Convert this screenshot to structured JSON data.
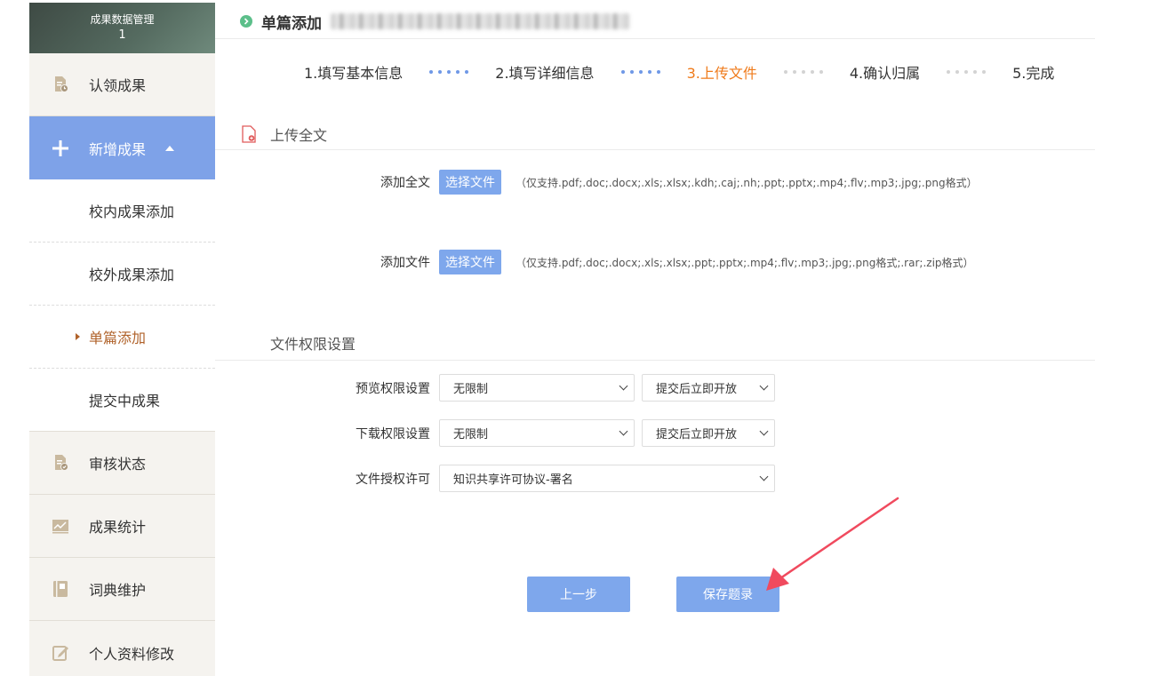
{
  "sidebar": {
    "header_title": "成果数据管理",
    "header_count": "1",
    "items": [
      {
        "label": "认领成果",
        "icon": "document-clock-icon"
      },
      {
        "label": "新增成果",
        "icon": "plus-icon"
      },
      {
        "label": "校内成果添加"
      },
      {
        "label": "校外成果添加"
      },
      {
        "label": "单篇添加"
      },
      {
        "label": "提交中成果"
      },
      {
        "label": "审核状态",
        "icon": "document-check-icon"
      },
      {
        "label": "成果统计",
        "icon": "chart-icon"
      },
      {
        "label": "词典维护",
        "icon": "book-icon"
      },
      {
        "label": "个人资料修改",
        "icon": "edit-icon"
      }
    ]
  },
  "header": {
    "title": "单篇添加"
  },
  "steps": [
    "1.填写基本信息",
    "2.填写详细信息",
    "3.上传文件",
    "4.确认归属",
    "5.完成"
  ],
  "current_step": 3,
  "upload": {
    "section_title": "上传全文",
    "rows": [
      {
        "label": "添加全文",
        "button": "选择文件",
        "hint": "（仅支持.pdf;.doc;.docx;.xls;.xlsx;.kdh;.caj;.nh;.ppt;.pptx;.mp4;.flv;.mp3;.jpg;.png格式）"
      },
      {
        "label": "添加文件",
        "button": "选择文件",
        "hint": "（仅支持.pdf;.doc;.docx;.xls;.xlsx;.ppt;.pptx;.mp4;.flv;.mp3;.jpg;.png格式;.rar;.zip格式）"
      }
    ]
  },
  "permissions": {
    "section_title": "文件权限设置",
    "preview": {
      "label": "预览权限设置",
      "value": "无限制",
      "timing": "提交后立即开放"
    },
    "download": {
      "label": "下载权限设置",
      "value": "无限制",
      "timing": "提交后立即开放"
    },
    "license": {
      "label": "文件授权许可",
      "value": "知识共享许可协议-署名"
    }
  },
  "actions": {
    "prev": "上一步",
    "save": "保存题录"
  },
  "colors": {
    "accent": "#7ea7ec",
    "current_step": "#ef7a1a",
    "sidebar_active": "#7ea2e8",
    "annotation_arrow": "#f04a5e"
  }
}
